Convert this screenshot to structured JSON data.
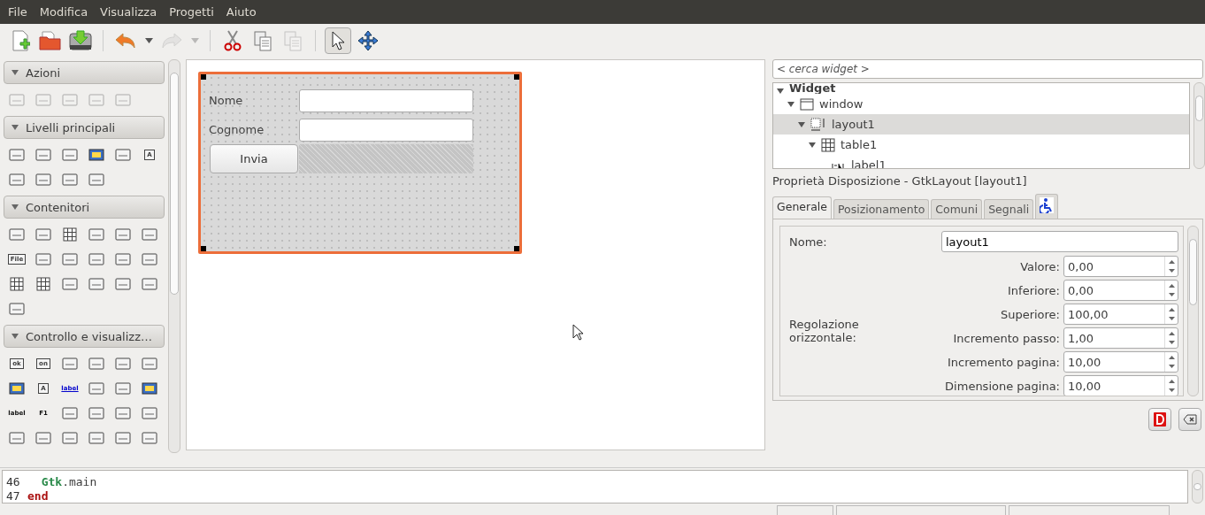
{
  "menu": [
    "File",
    "Modifica",
    "Visualizza",
    "Progetti",
    "Aiuto"
  ],
  "toolbar": [
    {
      "kind": "new",
      "disabled": false
    },
    {
      "kind": "open",
      "disabled": false
    },
    {
      "kind": "save",
      "disabled": false
    },
    {
      "kind": "sep"
    },
    {
      "kind": "undo",
      "disabled": false
    },
    {
      "kind": "drop",
      "disabled": false
    },
    {
      "kind": "redo",
      "disabled": true
    },
    {
      "kind": "drop",
      "disabled": true
    },
    {
      "kind": "sep"
    },
    {
      "kind": "cut",
      "disabled": false
    },
    {
      "kind": "copy",
      "disabled": false
    },
    {
      "kind": "paste",
      "disabled": true
    },
    {
      "kind": "sep"
    },
    {
      "kind": "pointer",
      "disabled": false,
      "selected": true
    },
    {
      "kind": "move",
      "disabled": false,
      "selected": false
    }
  ],
  "palette": [
    {
      "title": "Azioni",
      "expanded": true,
      "disabled": true,
      "items": [
        {
          "kind": "icon"
        },
        {
          "kind": "icon"
        },
        {
          "kind": "icon"
        },
        {
          "kind": "icon"
        },
        {
          "kind": "icon"
        }
      ]
    },
    {
      "title": "Livelli principali",
      "expanded": true,
      "disabled": false,
      "items": [
        {
          "kind": "icon"
        },
        {
          "kind": "icon"
        },
        {
          "kind": "icon"
        },
        {
          "kind": "color"
        },
        {
          "kind": "icon"
        },
        {
          "kind": "text",
          "text": "A"
        },
        {
          "kind": "icon"
        },
        {
          "kind": "icon"
        },
        {
          "kind": "icon"
        },
        {
          "kind": "icon"
        }
      ]
    },
    {
      "title": "Contenitori",
      "expanded": true,
      "disabled": false,
      "items": [
        {
          "kind": "icon"
        },
        {
          "kind": "icon"
        },
        {
          "kind": "grid"
        },
        {
          "kind": "icon"
        },
        {
          "kind": "icon"
        },
        {
          "kind": "icon"
        },
        {
          "kind": "text",
          "text": "File"
        },
        {
          "kind": "icon"
        },
        {
          "kind": "icon"
        },
        {
          "kind": "icon"
        },
        {
          "kind": "icon"
        },
        {
          "kind": "icon"
        },
        {
          "kind": "grid"
        },
        {
          "kind": "grid"
        },
        {
          "kind": "icon"
        },
        {
          "kind": "icon"
        },
        {
          "kind": "icon"
        },
        {
          "kind": "icon"
        },
        {
          "kind": "icon"
        }
      ]
    },
    {
      "title": "Controllo e visualizz…",
      "expanded": true,
      "disabled": false,
      "items": [
        {
          "kind": "text",
          "text": "ok"
        },
        {
          "kind": "text",
          "text": "on"
        },
        {
          "kind": "icon"
        },
        {
          "kind": "icon"
        },
        {
          "kind": "icon"
        },
        {
          "kind": "icon"
        },
        {
          "kind": "color"
        },
        {
          "kind": "text",
          "text": "A"
        },
        {
          "kind": "link",
          "text": "label"
        },
        {
          "kind": "icon"
        },
        {
          "kind": "icon"
        },
        {
          "kind": "color"
        },
        {
          "kind": "plain",
          "text": "label"
        },
        {
          "kind": "plain",
          "text": "F1"
        },
        {
          "kind": "icon"
        },
        {
          "kind": "icon"
        },
        {
          "kind": "icon"
        },
        {
          "kind": "icon"
        },
        {
          "kind": "icon"
        },
        {
          "kind": "icon"
        },
        {
          "kind": "icon"
        },
        {
          "kind": "icon"
        },
        {
          "kind": "icon"
        },
        {
          "kind": "icon"
        }
      ]
    }
  ],
  "design": {
    "rows": [
      {
        "label": "Nome",
        "kind": "entry"
      },
      {
        "label": "Cognome",
        "kind": "entry"
      }
    ],
    "button": "Invia"
  },
  "search": {
    "placeholder": "< cerca widget >"
  },
  "tree": [
    {
      "name": "Widget",
      "kind": "header",
      "selected": false,
      "expanded": true,
      "children": [
        {
          "name": "window",
          "kind": "window",
          "selected": false,
          "expanded": true,
          "children": [
            {
              "name": "layout1",
              "kind": "layout",
              "selected": true,
              "expanded": true,
              "children": [
                {
                  "name": "table1",
                  "kind": "table",
                  "selected": false,
                  "expanded": true,
                  "children": [
                    {
                      "name": "label1",
                      "kind": "label",
                      "selected": false
                    }
                  ]
                }
              ]
            }
          ]
        }
      ]
    }
  ],
  "properties": {
    "title": "Proprietà Disposizione - GtkLayout [layout1]",
    "tabs": [
      {
        "label": "Generale",
        "selected": true
      },
      {
        "label": "Posizionamento",
        "selected": false
      },
      {
        "label": "Comuni",
        "selected": false
      },
      {
        "label": "Segnali",
        "selected": false
      },
      {
        "kind": "accessibility",
        "selected": false
      }
    ],
    "name_label": "Nome:",
    "name_value": "layout1",
    "group_label": "Regolazione orizzontale:",
    "fields": [
      {
        "label": "Valore:",
        "value": "0,00"
      },
      {
        "label": "Inferiore:",
        "value": "0,00"
      },
      {
        "label": "Superiore:",
        "value": "100,00"
      },
      {
        "label": "Incremento passo:",
        "value": "1,00"
      },
      {
        "label": "Incremento pagina:",
        "value": "10,00"
      },
      {
        "label": "Dimensione pagina:",
        "value": "10,00"
      }
    ]
  },
  "editor": [
    {
      "number": "46",
      "kind": "call",
      "object": "Gtk",
      "method": ".main"
    },
    {
      "number": "47",
      "kind": "keyword",
      "text": "end"
    }
  ]
}
